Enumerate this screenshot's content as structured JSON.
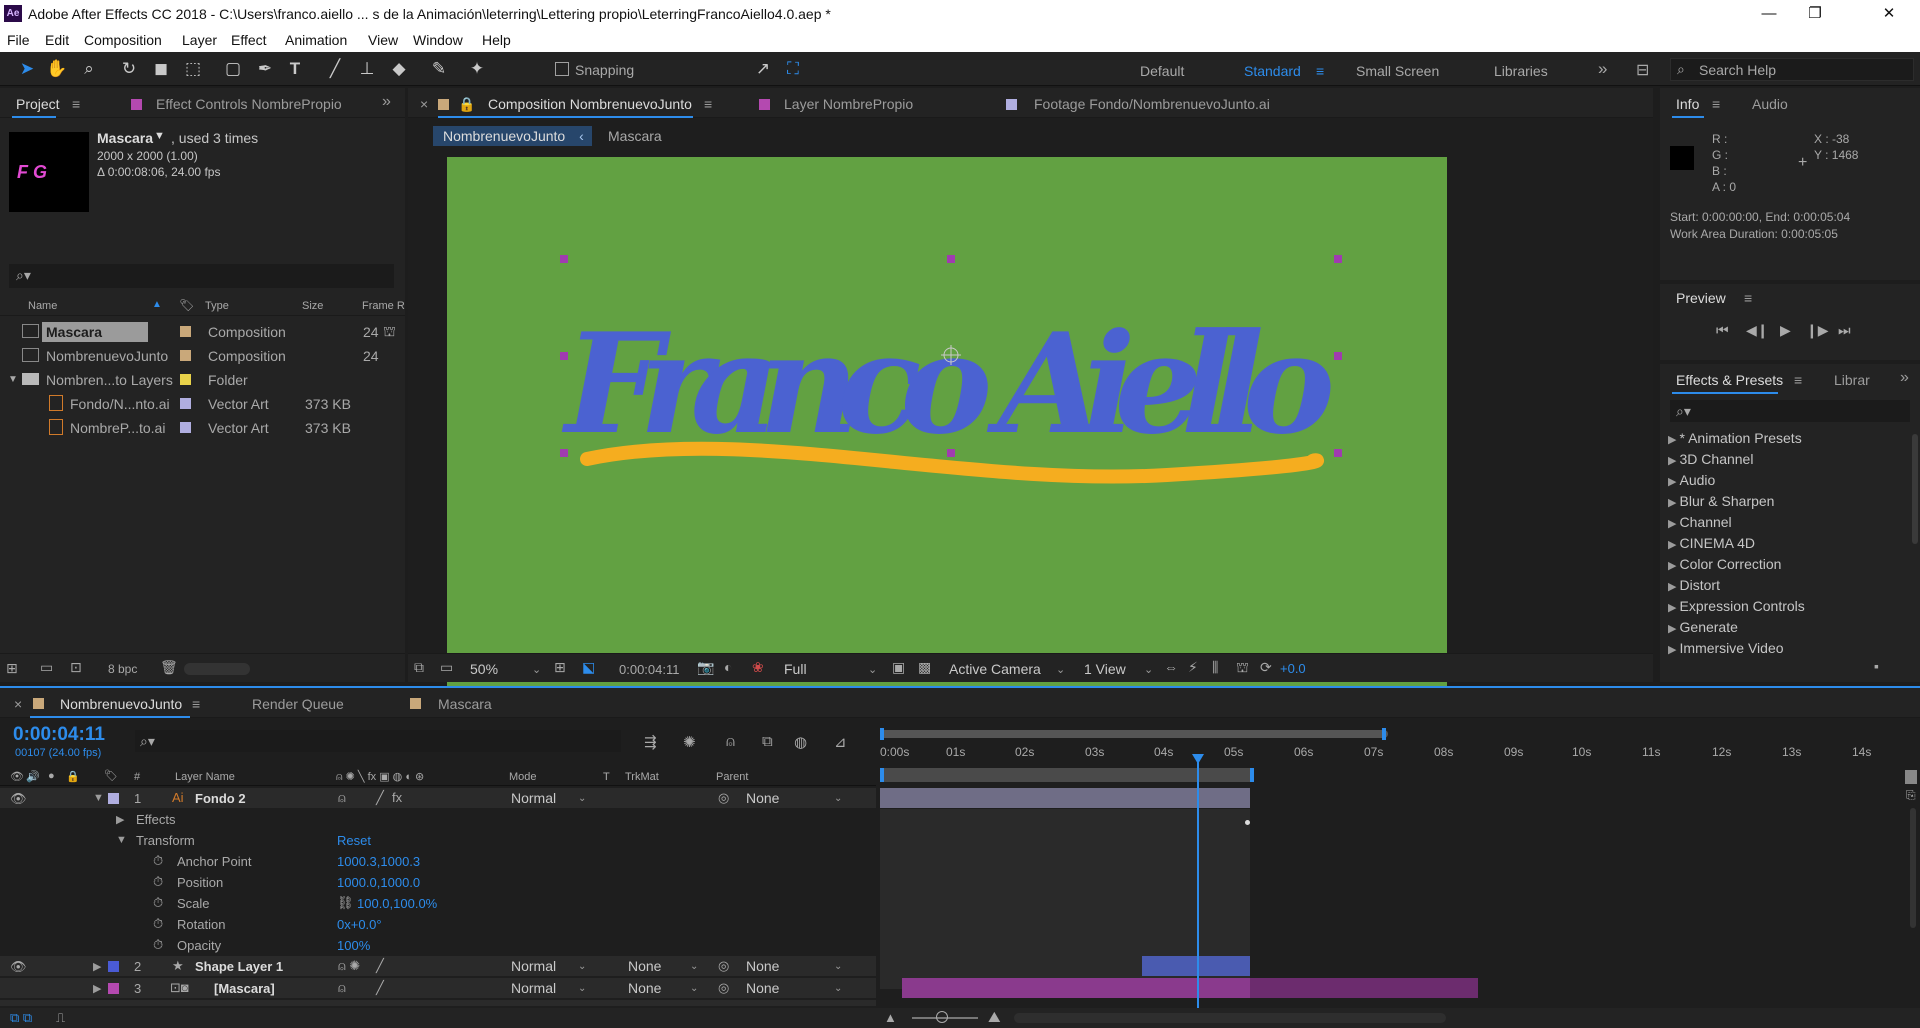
{
  "window": {
    "title": "Adobe After Effects CC 2018 - C:\\Users\\franco.aiello ... s de la Animación\\leterring\\Lettering propio\\LeterringFrancoAiello4.0.aep *",
    "logo": "Ae"
  },
  "menu": [
    "File",
    "Edit",
    "Composition",
    "Layer",
    "Effect",
    "Animation",
    "View",
    "Window",
    "Help"
  ],
  "toolbar": {
    "snapping": "Snapping",
    "workspaces": [
      "Default",
      "Standard",
      "Small Screen",
      "Libraries"
    ],
    "active_workspace": "Standard",
    "search_placeholder": "Search Help"
  },
  "project": {
    "tabs": [
      "Project",
      "Effect Controls NombrePropio"
    ],
    "selected_name": "Mascara",
    "used": ", used 3 times",
    "dims": "2000 x 2000 (1.00)",
    "duration": "Δ 0:00:08:06, 24.00 fps",
    "thumb_text": "F G",
    "columns": [
      "Name",
      "Type",
      "Size",
      "Frame R"
    ],
    "items": [
      {
        "name": "Mascara",
        "type": "Composition",
        "size": "",
        "frame": "24",
        "swatch": "#c9a87a",
        "kind": "comp",
        "selected": true
      },
      {
        "name": "NombrenuevoJunto",
        "type": "Composition",
        "size": "",
        "frame": "24",
        "swatch": "#c9a87a",
        "kind": "comp"
      },
      {
        "name": "Nombren...to Layers",
        "type": "Folder",
        "size": "",
        "frame": "",
        "swatch": "#e8d24a",
        "kind": "folder"
      },
      {
        "name": "Fondo/N...nto.ai",
        "type": "Vector Art",
        "size": "373 KB",
        "frame": "",
        "swatch": "#b0aee0",
        "kind": "ai"
      },
      {
        "name": "NombreP...to.ai",
        "type": "Vector Art",
        "size": "373 KB",
        "frame": "",
        "swatch": "#b0aee0",
        "kind": "ai"
      }
    ],
    "bpc": "8 bpc"
  },
  "viewer": {
    "tabs": [
      "Composition NombrenuevoJunto",
      "Layer NombrePropio",
      "Footage Fondo/NombrenuevoJunto.ai"
    ],
    "breadcrumbs": [
      "NombrenuevoJunto",
      "Mascara"
    ],
    "lettering": "Franco Aiello",
    "zoom": "50%",
    "timecode": "0:00:04:11",
    "resolution": "Full",
    "camera": "Active Camera",
    "views": "1 View",
    "exposure": "+0.0",
    "colors": {
      "bg": "#62a142",
      "text": "#4b62d1",
      "swash": "#f5ad1f"
    }
  },
  "info": {
    "tabs": [
      "Info",
      "Audio"
    ],
    "r": "R :",
    "g": "G :",
    "b": "B :",
    "a": "A : 0",
    "x": "X : -38",
    "y": "Y : 1468",
    "start": "Start: 0:00:00:00, End: 0:00:05:04",
    "work": "Work Area Duration: 0:00:05:05"
  },
  "preview": {
    "title": "Preview"
  },
  "effects": {
    "tabs": [
      "Effects & Presets",
      "Librar"
    ],
    "items": [
      "* Animation Presets",
      "3D Channel",
      "Audio",
      "Blur & Sharpen",
      "Channel",
      "CINEMA 4D",
      "Color Correction",
      "Distort",
      "Expression Controls",
      "Generate",
      "Immersive Video"
    ]
  },
  "timeline": {
    "tabs": [
      "NombrenuevoJunto",
      "Render Queue",
      "Mascara"
    ],
    "timecode": "0:00:04:11",
    "frame_info": "00107 (24.00 fps)",
    "ruler": [
      "0:00s",
      "01s",
      "02s",
      "03s",
      "04s",
      "05s",
      "06s",
      "07s",
      "08s",
      "09s",
      "10s",
      "11s",
      "12s",
      "13s",
      "14s"
    ],
    "headers": {
      "num": "#",
      "layer": "Layer Name",
      "mode": "Mode",
      "t": "T",
      "trkmat": "TrkMat",
      "parent": "Parent"
    },
    "layer1": {
      "num": "1",
      "name": "Fondo 2",
      "mode": "Normal",
      "parent": "None"
    },
    "effects_label": "Effects",
    "transform_label": "Transform",
    "reset": "Reset",
    "props": [
      {
        "name": "Anchor Point",
        "value": "1000.3,1000.3"
      },
      {
        "name": "Position",
        "value": "1000.0,1000.0"
      },
      {
        "name": "Scale",
        "value": "100.0,100.0%"
      },
      {
        "name": "Rotation",
        "value": "0x+0.0°"
      },
      {
        "name": "Opacity",
        "value": "100%"
      }
    ],
    "layer2": {
      "num": "2",
      "name": "Shape Layer 1",
      "mode": "Normal",
      "trkmat": "None",
      "parent": "None"
    },
    "layer3": {
      "num": "3",
      "name": "[Mascara]",
      "mode": "Normal",
      "trkmat": "None",
      "parent": "None"
    }
  }
}
